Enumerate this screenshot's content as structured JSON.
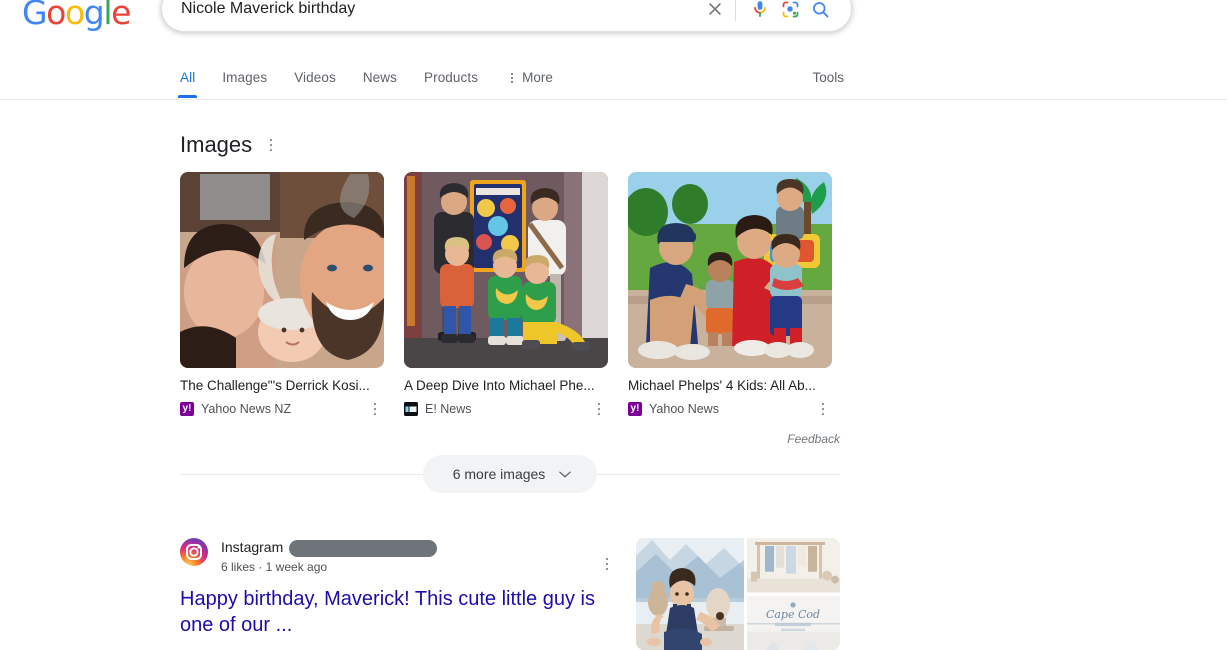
{
  "brand": {
    "logo_letters": [
      "G",
      "o",
      "o",
      "g",
      "l",
      "e"
    ],
    "colors": {
      "blue": "#4285F4",
      "red": "#EA4335",
      "yellow": "#FBBC05",
      "green": "#34A853",
      "link": "#1a0dab",
      "accent": "#1a73e8"
    }
  },
  "search": {
    "query": "Nicole Maverick birthday",
    "placeholder": "Search",
    "clear_icon": "close-icon",
    "voice_icon": "microphone-icon",
    "lens_icon": "google-lens-icon",
    "submit_icon": "search-icon"
  },
  "nav": {
    "tabs": [
      {
        "label": "All",
        "active": true
      },
      {
        "label": "Images",
        "active": false
      },
      {
        "label": "Videos",
        "active": false
      },
      {
        "label": "News",
        "active": false
      },
      {
        "label": "Products",
        "active": false
      }
    ],
    "more_label": "More",
    "more_icon": "kebab-menu-icon",
    "tools_label": "Tools"
  },
  "images_block": {
    "heading": "Images",
    "heading_menu_icon": "kebab-menu-icon",
    "tiles": [
      {
        "caption": "The Challenge\"'s Derrick Kosi...",
        "source": "Yahoo News NZ",
        "favicon": "yahoo-favicon",
        "menu_icon": "kebab-menu-icon"
      },
      {
        "caption": "A Deep Dive Into Michael Phe...",
        "source": "E! News",
        "favicon": "enews-favicon",
        "menu_icon": "kebab-menu-icon"
      },
      {
        "caption": "Michael Phelps' 4 Kids: All Ab...",
        "source": "Yahoo News",
        "favicon": "yahoo-favicon",
        "menu_icon": "kebab-menu-icon"
      }
    ],
    "feedback_label": "Feedback",
    "more_images_label": "6 more images",
    "more_images_icon": "chevron-down-icon"
  },
  "result": {
    "site_name": "Instagram",
    "handle_redacted": true,
    "meta": "6 likes · 1 week ago",
    "menu_icon": "kebab-menu-icon",
    "site_icon": "instagram-icon",
    "title": "Happy birthday, Maverick! This cute little guy is one of our ...",
    "snippet": "",
    "thumbnails": [
      "cake-smash-photo",
      "studio-rack-photo",
      "cape-cod-overlay-photo"
    ]
  }
}
